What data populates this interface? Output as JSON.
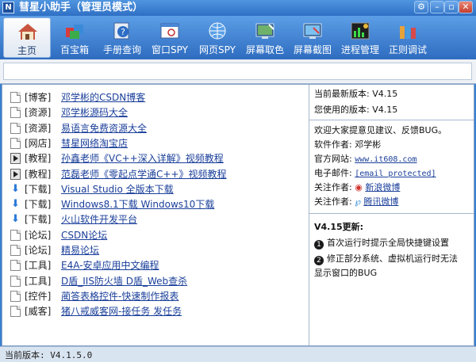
{
  "window": {
    "title": "彗星小助手（管理员模式）",
    "app_icon_letter": "N",
    "controls": [
      "settings",
      "minimize",
      "maximize",
      "close"
    ]
  },
  "toolbar": {
    "buttons": [
      {
        "label": "主页",
        "icon": "home-icon",
        "active": true
      },
      {
        "label": "百宝箱",
        "icon": "toolbox-icon",
        "active": false
      },
      {
        "label": "手册查询",
        "icon": "help-manual-icon",
        "active": false
      },
      {
        "label": "窗口SPY",
        "icon": "window-spy-icon",
        "active": false
      },
      {
        "label": "网页SPY",
        "icon": "web-spy-icon",
        "active": false
      },
      {
        "label": "屏幕取色",
        "icon": "color-picker-icon",
        "active": false
      },
      {
        "label": "屏幕截图",
        "icon": "screenshot-icon",
        "active": false
      },
      {
        "label": "进程管理",
        "icon": "process-manager-icon",
        "active": false
      },
      {
        "label": "正则调试",
        "icon": "regex-debug-icon",
        "active": false
      }
    ]
  },
  "links": [
    {
      "icon": "doc",
      "category": "[博客]",
      "text": "邓学彬的CSDN博客"
    },
    {
      "icon": "doc",
      "category": "[资源]",
      "text": "邓学彬源码大全"
    },
    {
      "icon": "doc",
      "category": "[资源]",
      "text": "易语言免费资源大全"
    },
    {
      "icon": "doc",
      "category": "[网店]",
      "text": "彗星网络淘宝店"
    },
    {
      "icon": "play",
      "category": "[教程]",
      "text": "孙鑫老师《VC++深入详解》视频教程"
    },
    {
      "icon": "play",
      "category": "[教程]",
      "text": "范磊老师《零起点学通C++》视频教程"
    },
    {
      "icon": "download",
      "category": "[下载]",
      "text": "Visual Studio 全版本下载"
    },
    {
      "icon": "download",
      "category": "[下载]",
      "text": "Windows8.1下载 Windows10下载"
    },
    {
      "icon": "download",
      "category": "[下载]",
      "text": "火山软件开发平台"
    },
    {
      "icon": "doc",
      "category": "[论坛]",
      "text": "CSDN论坛"
    },
    {
      "icon": "doc",
      "category": "[论坛]",
      "text": "精易论坛"
    },
    {
      "icon": "doc",
      "category": "[工具]",
      "text": "E4A-安卓应用中文编程"
    },
    {
      "icon": "doc",
      "category": "[工具]",
      "text": "D盾_IIS防火墙 D盾_Web查杀"
    },
    {
      "icon": "doc",
      "category": "[控件]",
      "text": "蔺答表格控件-快速制作报表"
    },
    {
      "icon": "doc",
      "category": "[威客]",
      "text": "猪八戒威客网-接任务 发任务"
    }
  ],
  "info": {
    "latest_version": "当前最新版本: V4.15",
    "your_version": "您使用的版本: V4.15",
    "welcome": "欢迎大家提意见建议、反馈BUG。",
    "author_label": "软件作者:",
    "author": "邓学彬",
    "site_label": "官方网站:",
    "site": "www.it608.com",
    "email_label": "电子邮件:",
    "email": "[email protected]",
    "follow_label": "关注作者:",
    "weibo_sina": "新浪微博",
    "weibo_tencent": "腾讯微博"
  },
  "update": {
    "title": "V4.15更新:",
    "items": [
      {
        "num": "1",
        "text": "首次运行时提示全局快捷键设置"
      },
      {
        "num": "2",
        "text": "修正部分系统、虚拟机运行时无法"
      },
      {
        "num": "",
        "text": "显示窗口的BUG"
      }
    ]
  },
  "status": {
    "text": "当前版本: V4.1.5.0"
  }
}
